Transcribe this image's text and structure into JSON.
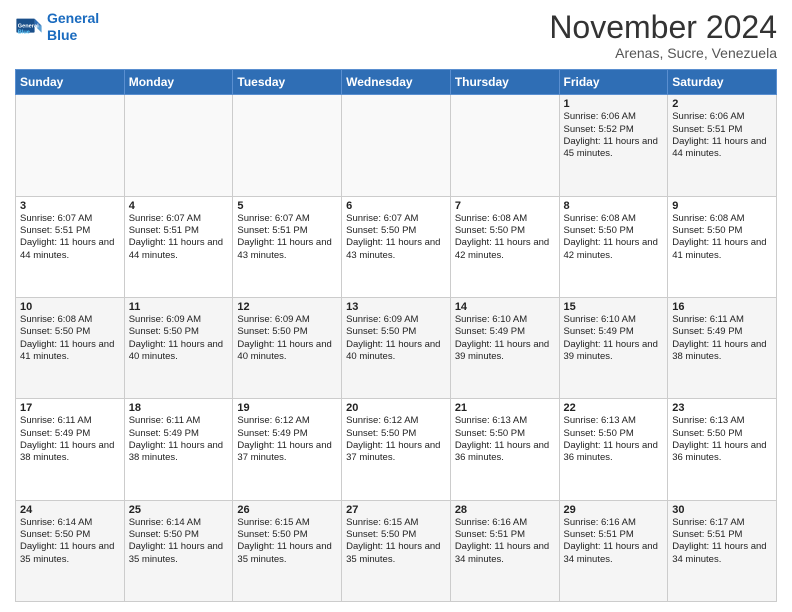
{
  "logo": {
    "line1": "General",
    "line2": "Blue"
  },
  "title": "November 2024",
  "subtitle": "Arenas, Sucre, Venezuela",
  "weekdays": [
    "Sunday",
    "Monday",
    "Tuesday",
    "Wednesday",
    "Thursday",
    "Friday",
    "Saturday"
  ],
  "weeks": [
    [
      {
        "day": "",
        "info": ""
      },
      {
        "day": "",
        "info": ""
      },
      {
        "day": "",
        "info": ""
      },
      {
        "day": "",
        "info": ""
      },
      {
        "day": "",
        "info": ""
      },
      {
        "day": "1",
        "info": "Sunrise: 6:06 AM\nSunset: 5:52 PM\nDaylight: 11 hours and 45 minutes."
      },
      {
        "day": "2",
        "info": "Sunrise: 6:06 AM\nSunset: 5:51 PM\nDaylight: 11 hours and 44 minutes."
      }
    ],
    [
      {
        "day": "3",
        "info": "Sunrise: 6:07 AM\nSunset: 5:51 PM\nDaylight: 11 hours and 44 minutes."
      },
      {
        "day": "4",
        "info": "Sunrise: 6:07 AM\nSunset: 5:51 PM\nDaylight: 11 hours and 44 minutes."
      },
      {
        "day": "5",
        "info": "Sunrise: 6:07 AM\nSunset: 5:51 PM\nDaylight: 11 hours and 43 minutes."
      },
      {
        "day": "6",
        "info": "Sunrise: 6:07 AM\nSunset: 5:50 PM\nDaylight: 11 hours and 43 minutes."
      },
      {
        "day": "7",
        "info": "Sunrise: 6:08 AM\nSunset: 5:50 PM\nDaylight: 11 hours and 42 minutes."
      },
      {
        "day": "8",
        "info": "Sunrise: 6:08 AM\nSunset: 5:50 PM\nDaylight: 11 hours and 42 minutes."
      },
      {
        "day": "9",
        "info": "Sunrise: 6:08 AM\nSunset: 5:50 PM\nDaylight: 11 hours and 41 minutes."
      }
    ],
    [
      {
        "day": "10",
        "info": "Sunrise: 6:08 AM\nSunset: 5:50 PM\nDaylight: 11 hours and 41 minutes."
      },
      {
        "day": "11",
        "info": "Sunrise: 6:09 AM\nSunset: 5:50 PM\nDaylight: 11 hours and 40 minutes."
      },
      {
        "day": "12",
        "info": "Sunrise: 6:09 AM\nSunset: 5:50 PM\nDaylight: 11 hours and 40 minutes."
      },
      {
        "day": "13",
        "info": "Sunrise: 6:09 AM\nSunset: 5:50 PM\nDaylight: 11 hours and 40 minutes."
      },
      {
        "day": "14",
        "info": "Sunrise: 6:10 AM\nSunset: 5:49 PM\nDaylight: 11 hours and 39 minutes."
      },
      {
        "day": "15",
        "info": "Sunrise: 6:10 AM\nSunset: 5:49 PM\nDaylight: 11 hours and 39 minutes."
      },
      {
        "day": "16",
        "info": "Sunrise: 6:11 AM\nSunset: 5:49 PM\nDaylight: 11 hours and 38 minutes."
      }
    ],
    [
      {
        "day": "17",
        "info": "Sunrise: 6:11 AM\nSunset: 5:49 PM\nDaylight: 11 hours and 38 minutes."
      },
      {
        "day": "18",
        "info": "Sunrise: 6:11 AM\nSunset: 5:49 PM\nDaylight: 11 hours and 38 minutes."
      },
      {
        "day": "19",
        "info": "Sunrise: 6:12 AM\nSunset: 5:49 PM\nDaylight: 11 hours and 37 minutes."
      },
      {
        "day": "20",
        "info": "Sunrise: 6:12 AM\nSunset: 5:50 PM\nDaylight: 11 hours and 37 minutes."
      },
      {
        "day": "21",
        "info": "Sunrise: 6:13 AM\nSunset: 5:50 PM\nDaylight: 11 hours and 36 minutes."
      },
      {
        "day": "22",
        "info": "Sunrise: 6:13 AM\nSunset: 5:50 PM\nDaylight: 11 hours and 36 minutes."
      },
      {
        "day": "23",
        "info": "Sunrise: 6:13 AM\nSunset: 5:50 PM\nDaylight: 11 hours and 36 minutes."
      }
    ],
    [
      {
        "day": "24",
        "info": "Sunrise: 6:14 AM\nSunset: 5:50 PM\nDaylight: 11 hours and 35 minutes."
      },
      {
        "day": "25",
        "info": "Sunrise: 6:14 AM\nSunset: 5:50 PM\nDaylight: 11 hours and 35 minutes."
      },
      {
        "day": "26",
        "info": "Sunrise: 6:15 AM\nSunset: 5:50 PM\nDaylight: 11 hours and 35 minutes."
      },
      {
        "day": "27",
        "info": "Sunrise: 6:15 AM\nSunset: 5:50 PM\nDaylight: 11 hours and 35 minutes."
      },
      {
        "day": "28",
        "info": "Sunrise: 6:16 AM\nSunset: 5:51 PM\nDaylight: 11 hours and 34 minutes."
      },
      {
        "day": "29",
        "info": "Sunrise: 6:16 AM\nSunset: 5:51 PM\nDaylight: 11 hours and 34 minutes."
      },
      {
        "day": "30",
        "info": "Sunrise: 6:17 AM\nSunset: 5:51 PM\nDaylight: 11 hours and 34 minutes."
      }
    ]
  ]
}
